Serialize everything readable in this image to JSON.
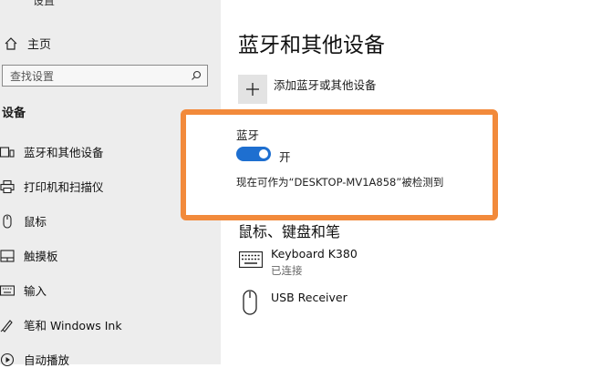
{
  "sidebar": {
    "window_title": "设置",
    "home": "主页",
    "search_placeholder": "查找设置",
    "section": "设备",
    "items": [
      {
        "label": "蓝牙和其他设备",
        "icon": "bluetooth-devices-icon"
      },
      {
        "label": "打印机和扫描仪",
        "icon": "printer-icon"
      },
      {
        "label": "鼠标",
        "icon": "mouse-icon"
      },
      {
        "label": "触摸板",
        "icon": "touchpad-icon"
      },
      {
        "label": "输入",
        "icon": "keyboard-icon"
      },
      {
        "label": "笔和 Windows Ink",
        "icon": "pen-icon"
      },
      {
        "label": "自动播放",
        "icon": "autoplay-icon"
      }
    ]
  },
  "main": {
    "title": "蓝牙和其他设备",
    "add_device": "添加蓝牙或其他设备",
    "bluetooth": {
      "label": "蓝牙",
      "toggle_state": "开",
      "discoverable_text": "现在可作为“DESKTOP-MV1A858”被检测到"
    },
    "section_title": "鼠标、键盘和笔",
    "devices": [
      {
        "name": "Keyboard K380",
        "status": "已连接",
        "icon": "keyboard-icon"
      },
      {
        "name": "USB Receiver",
        "status": "",
        "icon": "mouse-icon"
      }
    ]
  },
  "colors": {
    "accent": "#1e6fd0",
    "highlight": "#f28a3b",
    "sidebar_bg": "#ededed"
  }
}
